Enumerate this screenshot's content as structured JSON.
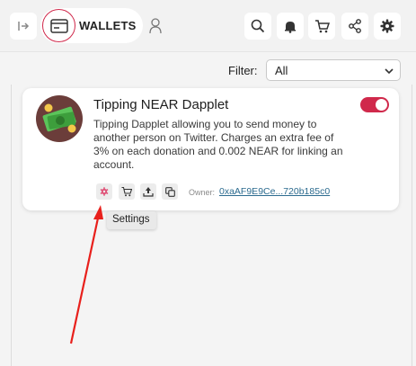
{
  "header": {
    "wallets_label": "WALLETS",
    "icons": [
      "sidebar-toggle-icon",
      "wallet-icon",
      "user-icon",
      "search-icon",
      "bell-icon",
      "cart-icon",
      "share-icon",
      "gear-icon"
    ]
  },
  "filter": {
    "label": "Filter:",
    "value": "All"
  },
  "card": {
    "title": "Tipping NEAR Dapplet",
    "description": "Tipping Dapplet allowing you to send money to another person on Twitter. Charges an extra fee of 3% on each donation and 0.002 NEAR for linking an account.",
    "enabled": true,
    "owner_label": "Owner:",
    "owner_value": "0xaAF9E9Ce...720b185c0",
    "actions": [
      "settings-icon",
      "cart-icon",
      "upload-icon",
      "copy-icon"
    ]
  },
  "tooltip": {
    "text": "Settings"
  },
  "colors": {
    "accent": "#d0294b",
    "header_bg": "#f2f2f2",
    "link": "#2c6b8f",
    "annotation_arrow": "#e8201c"
  }
}
